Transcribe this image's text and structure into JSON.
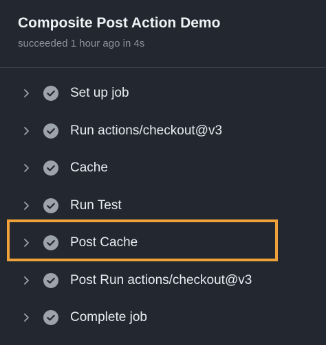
{
  "header": {
    "title": "Composite Post Action Demo",
    "subtitle": "succeeded 1 hour ago in 4s"
  },
  "steps": [
    {
      "label": "Set up job",
      "status": "success"
    },
    {
      "label": "Run actions/checkout@v3",
      "status": "success"
    },
    {
      "label": "Cache",
      "status": "success"
    },
    {
      "label": "Run Test",
      "status": "success"
    },
    {
      "label": "Post Cache",
      "status": "success",
      "highlighted": true
    },
    {
      "label": "Post Run actions/checkout@v3",
      "status": "success"
    },
    {
      "label": "Complete job",
      "status": "success"
    }
  ],
  "icons": {
    "expand": "chevron-right-icon",
    "status": "check-circle-icon"
  },
  "colors": {
    "background": "#23272f",
    "highlight": "#f0a23a",
    "check_fill": "#9da3ab"
  }
}
